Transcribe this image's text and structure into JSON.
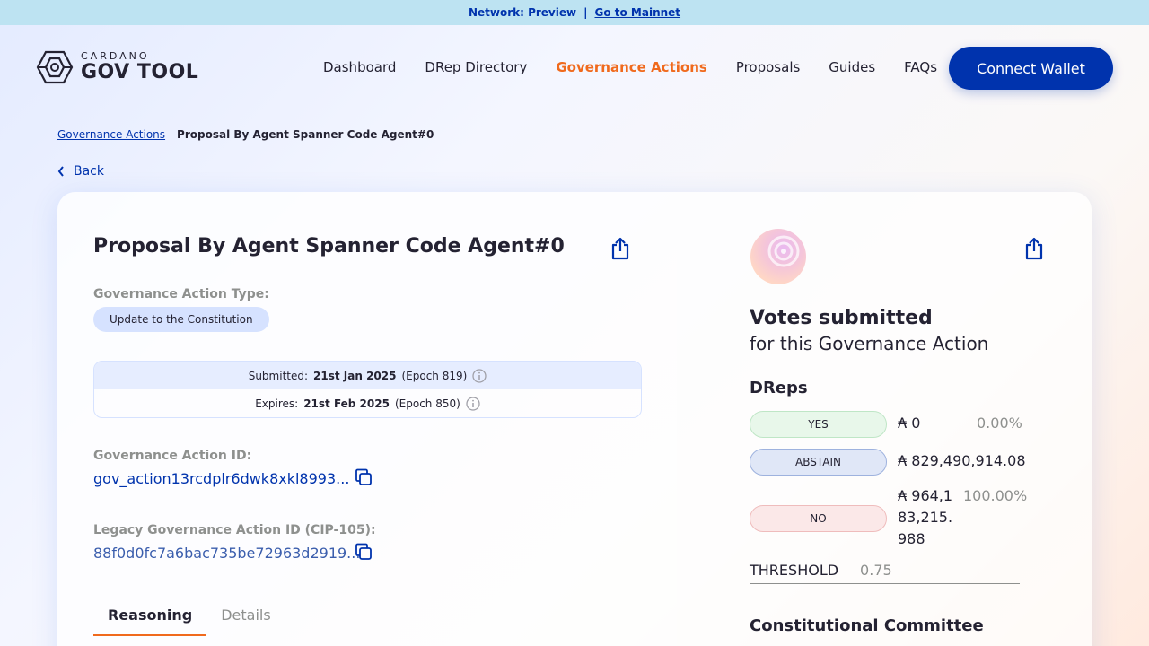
{
  "network_bar": {
    "network_label": "Network: Preview",
    "separator": "|",
    "mainnet_link": "Go to Mainnet"
  },
  "header": {
    "logo_small": "CARDANO",
    "logo_big": "GOV TOOL",
    "nav": [
      "Dashboard",
      "DRep Directory",
      "Governance Actions",
      "Proposals",
      "Guides",
      "FAQs"
    ],
    "active_nav": "Governance Actions",
    "connect_button": "Connect Wallet"
  },
  "breadcrumb": {
    "parent": "Governance Actions",
    "current": "Proposal By Agent Spanner Code Agent#0"
  },
  "back_label": "Back",
  "proposal": {
    "title": "Proposal By Agent Spanner Code Agent#0",
    "type_label": "Governance Action Type:",
    "type_value": "Update to the Constitution",
    "submitted_prefix": "Submitted:",
    "submitted_date": "21st Jan 2025",
    "submitted_epoch": "(Epoch 819)",
    "expires_prefix": "Expires:",
    "expires_date": "21st Feb 2025",
    "expires_epoch": "(Epoch 850)",
    "id_label": "Governance Action ID:",
    "id_value": "gov_action13rcdplr6dwk8xkl8993...",
    "legacy_id_label": "Legacy Governance Action ID (CIP-105):",
    "legacy_id_value": "88f0d0fc7a6bac735be72963d2919...",
    "tabs": [
      "Reasoning",
      "Details"
    ],
    "active_tab": "Reasoning"
  },
  "votes": {
    "title": "Votes submitted",
    "subtitle": "for this Governance Action",
    "dreps_heading": "DReps",
    "rows": [
      {
        "label": "YES",
        "amount": "₳ 0",
        "percent": "0.00%"
      },
      {
        "label": "ABSTAIN",
        "amount": "₳ 829,490,914.08",
        "percent": ""
      },
      {
        "label": "NO",
        "amount": "₳ 964,183,215.988",
        "percent": "100.00%"
      }
    ],
    "threshold_label": "THRESHOLD",
    "threshold_value": "0.75",
    "cc_heading": "Constitutional Committee"
  }
}
